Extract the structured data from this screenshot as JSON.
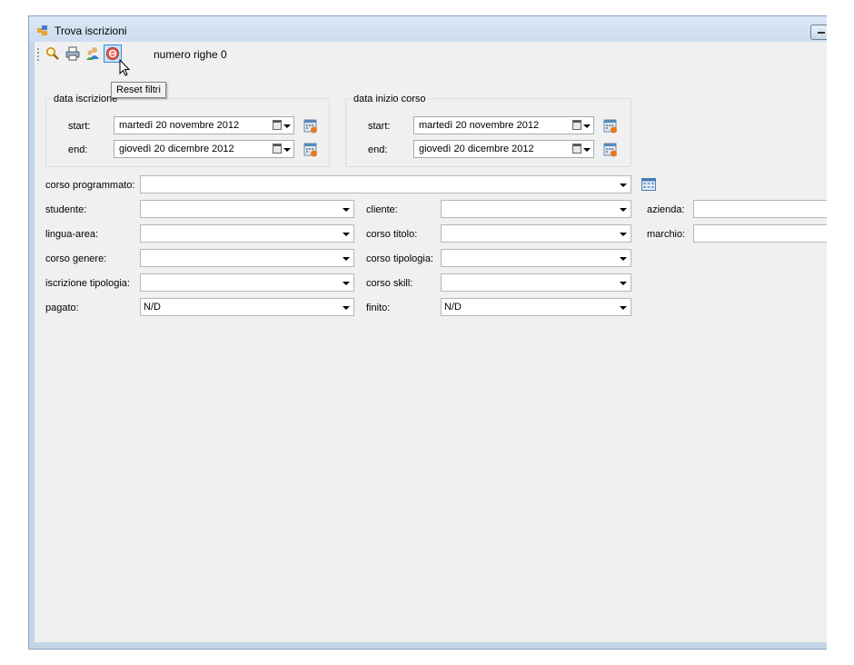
{
  "window": {
    "title": "Trova iscrizioni"
  },
  "toolbar": {
    "buttons": [
      {
        "name": "search-icon",
        "tooltip": ""
      },
      {
        "name": "print-icon",
        "tooltip": ""
      },
      {
        "name": "users-icon",
        "tooltip": ""
      },
      {
        "name": "reset-icon",
        "tooltip": "Reset filtri"
      }
    ],
    "row_count_label": "numero righe 0",
    "tooltip": "Reset filtri"
  },
  "data_iscrizione": {
    "legend": "data iscrizione",
    "start_label": "start:",
    "start_value": "martedì  20 novembre 2012",
    "end_label": "end:",
    "end_value": "giovedì  20 dicembre 2012"
  },
  "data_inizio_corso": {
    "legend": "data inizio corso",
    "start_label": "start:",
    "start_value": "martedì  20 novembre 2012",
    "end_label": "end:",
    "end_value": "giovedì  20 dicembre 2012"
  },
  "fields": {
    "corso_programmato": {
      "label": "corso programmato:",
      "value": ""
    },
    "studente": {
      "label": "studente:",
      "value": ""
    },
    "cliente": {
      "label": "cliente:",
      "value": ""
    },
    "azienda": {
      "label": "azienda:",
      "value": ""
    },
    "lingua_area": {
      "label": "lingua-area:",
      "value": ""
    },
    "corso_titolo": {
      "label": "corso titolo:",
      "value": ""
    },
    "marchio": {
      "label": "marchio:",
      "value": ""
    },
    "corso_genere": {
      "label": "corso genere:",
      "value": ""
    },
    "corso_tipologia": {
      "label": "corso tipologia:",
      "value": ""
    },
    "iscrizione_tipologia": {
      "label": "iscrizione tipologia:",
      "value": ""
    },
    "corso_skill": {
      "label": "corso skill:",
      "value": ""
    },
    "pagato": {
      "label": "pagato:",
      "value": "N/D"
    },
    "finito": {
      "label": "finito:",
      "value": "N/D"
    }
  }
}
